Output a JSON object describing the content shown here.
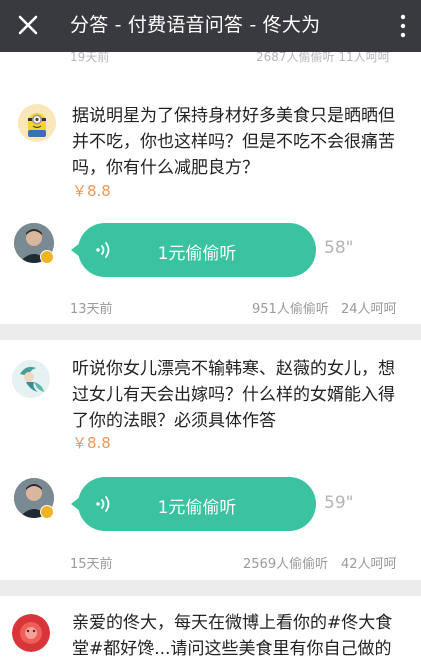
{
  "header": {
    "title": "分答 - 付费语音问答 - 佟大为"
  },
  "prev_card": {
    "meta_left": "19天前",
    "meta_right": "2687人偷偷听  11人呵呵"
  },
  "posts": [
    {
      "question": "据说明星为了保持身材好多美食只是晒晒但并不吃，你也这样吗？但是不吃不会很痛苦吗，你有什么减肥良方？",
      "price": "￥8.8",
      "listen_label": "1元偷偷听",
      "duration": "58\"",
      "time_ago": "13天前",
      "listens": "951人偷偷听",
      "laughs": "24人呵呵",
      "asker_avatar": "minion-avatar"
    },
    {
      "question": "听说你女儿漂亮不输韩寒、赵薇的女儿，想过女儿有天会出嫁吗？什么样的女婿能入得了你的法眼？必须具体作答",
      "price": "￥8.8",
      "listen_label": "1元偷偷听",
      "duration": "59\"",
      "time_ago": "15天前",
      "listens": "2569人偷偷听",
      "laughs": "42人呵呵",
      "asker_avatar": "mermaid-avatar"
    },
    {
      "question": "亲爱的佟大，每天在微博上看你的#佟大食堂#都好馋...请问这些美食里有你自己做的",
      "asker_avatar": "flower-avatar"
    }
  ],
  "colors": {
    "topbar": "#393a3f",
    "bubble": "#3bc3a1",
    "price": "#e99a5d",
    "badge": "#f0b324"
  },
  "icons": {
    "close": "close-icon",
    "more": "more-vertical-icon",
    "sound": "sound-wave-icon",
    "verified": "verified-badge-icon"
  }
}
